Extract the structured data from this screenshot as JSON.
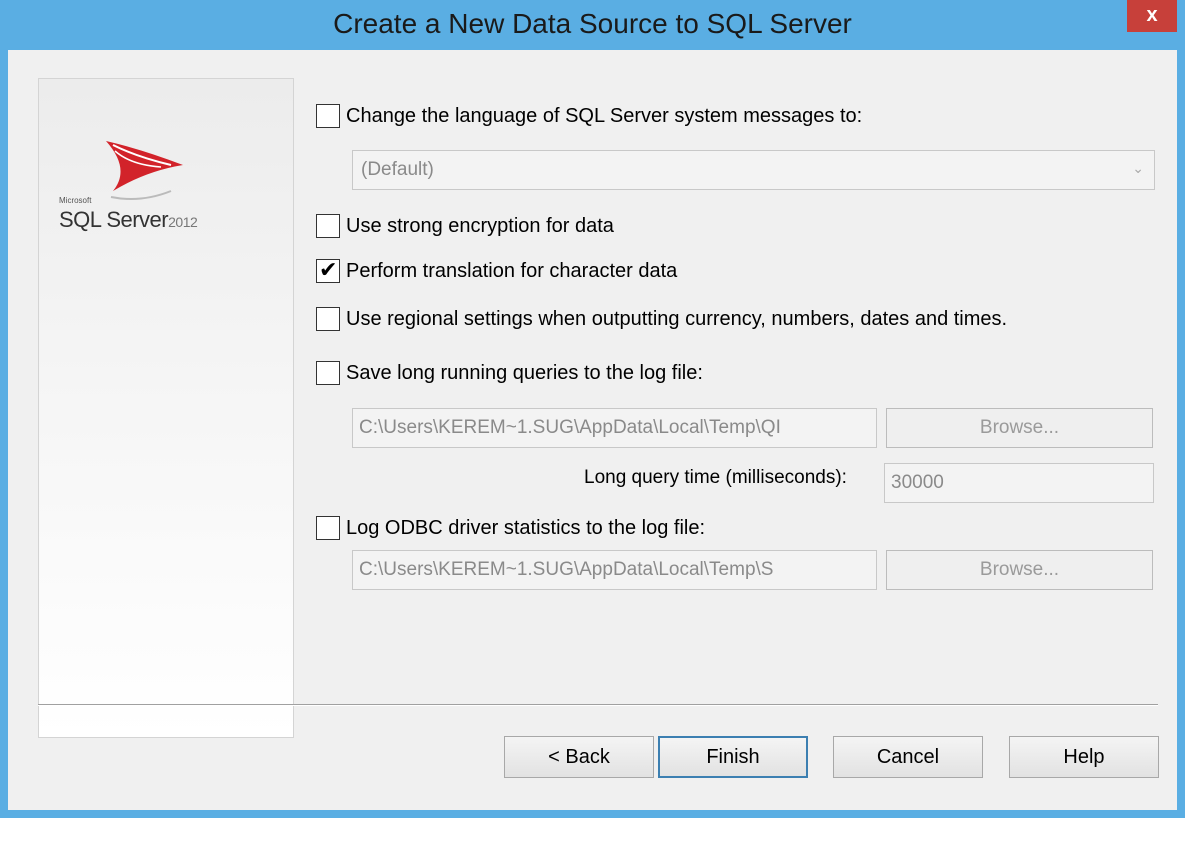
{
  "window": {
    "title": "Create a New Data Source to SQL Server",
    "close_label": "x"
  },
  "banner": {
    "ms_label": "Microsoft",
    "product": "SQL Server",
    "year": "2012"
  },
  "options": {
    "change_language": {
      "label": "Change the language of SQL Server system messages to:",
      "checked": false
    },
    "language_combo": {
      "value": "(Default)"
    },
    "strong_encryption": {
      "label": "Use strong encryption for data",
      "checked": false
    },
    "translation": {
      "label": "Perform translation for character data",
      "checked": true
    },
    "regional": {
      "label": "Use regional settings when outputting currency, numbers, dates and times.",
      "checked": false
    },
    "save_long_queries": {
      "label": "Save long running queries to the log file:",
      "checked": false
    },
    "query_log_path": "C:\\Users\\KEREM~1.SUG\\AppData\\Local\\Temp\\QI",
    "query_browse": "Browse...",
    "long_query_label": "Long query time (milliseconds):",
    "long_query_value": "30000",
    "log_stats": {
      "label": "Log ODBC driver statistics to the log file:",
      "checked": false
    },
    "stats_log_path": "C:\\Users\\KEREM~1.SUG\\AppData\\Local\\Temp\\S",
    "stats_browse": "Browse..."
  },
  "buttons": {
    "back": "< Back",
    "finish": "Finish",
    "cancel": "Cancel",
    "help": "Help"
  },
  "colors": {
    "titlebar": "#5aaee3",
    "close": "#c7403a",
    "dialog_bg": "#f0f0f0"
  }
}
